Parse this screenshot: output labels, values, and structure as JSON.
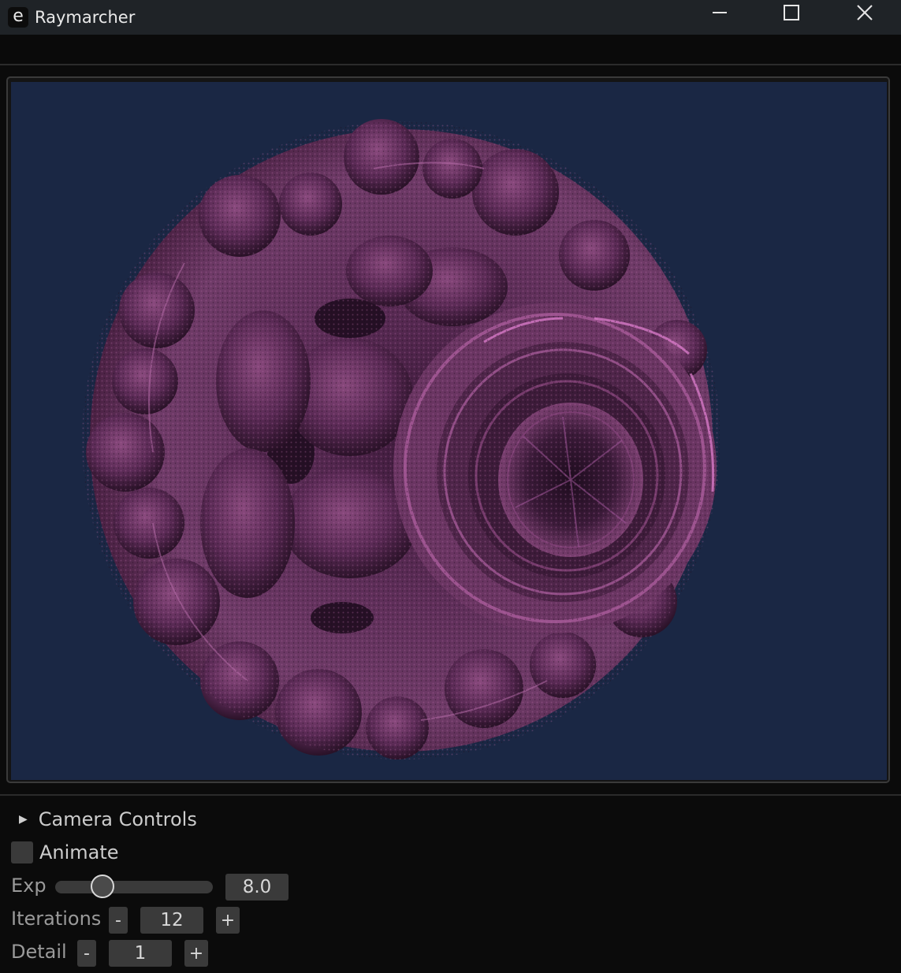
{
  "window": {
    "title": "Raymarcher",
    "icon_letter": "e",
    "controls": [
      "minimize-icon",
      "maximize-icon",
      "close-icon"
    ]
  },
  "viewport": {
    "background": "#1a2744",
    "fractal_colors": [
      "#2a1228",
      "#4a2143",
      "#6e3a66",
      "#9a4d8a",
      "#d26cc0"
    ]
  },
  "panel": {
    "camera_controls": "Camera Controls",
    "animate": {
      "label": "Animate",
      "checked": false
    },
    "exp": {
      "label": "Exp",
      "value": "8.0",
      "fraction": 0.3
    },
    "iterations": {
      "label": "Iterations",
      "minus": "-",
      "value": "12",
      "plus": "+"
    },
    "detail": {
      "label": "Detail",
      "minus": "-",
      "value": "1",
      "plus": "+"
    }
  }
}
